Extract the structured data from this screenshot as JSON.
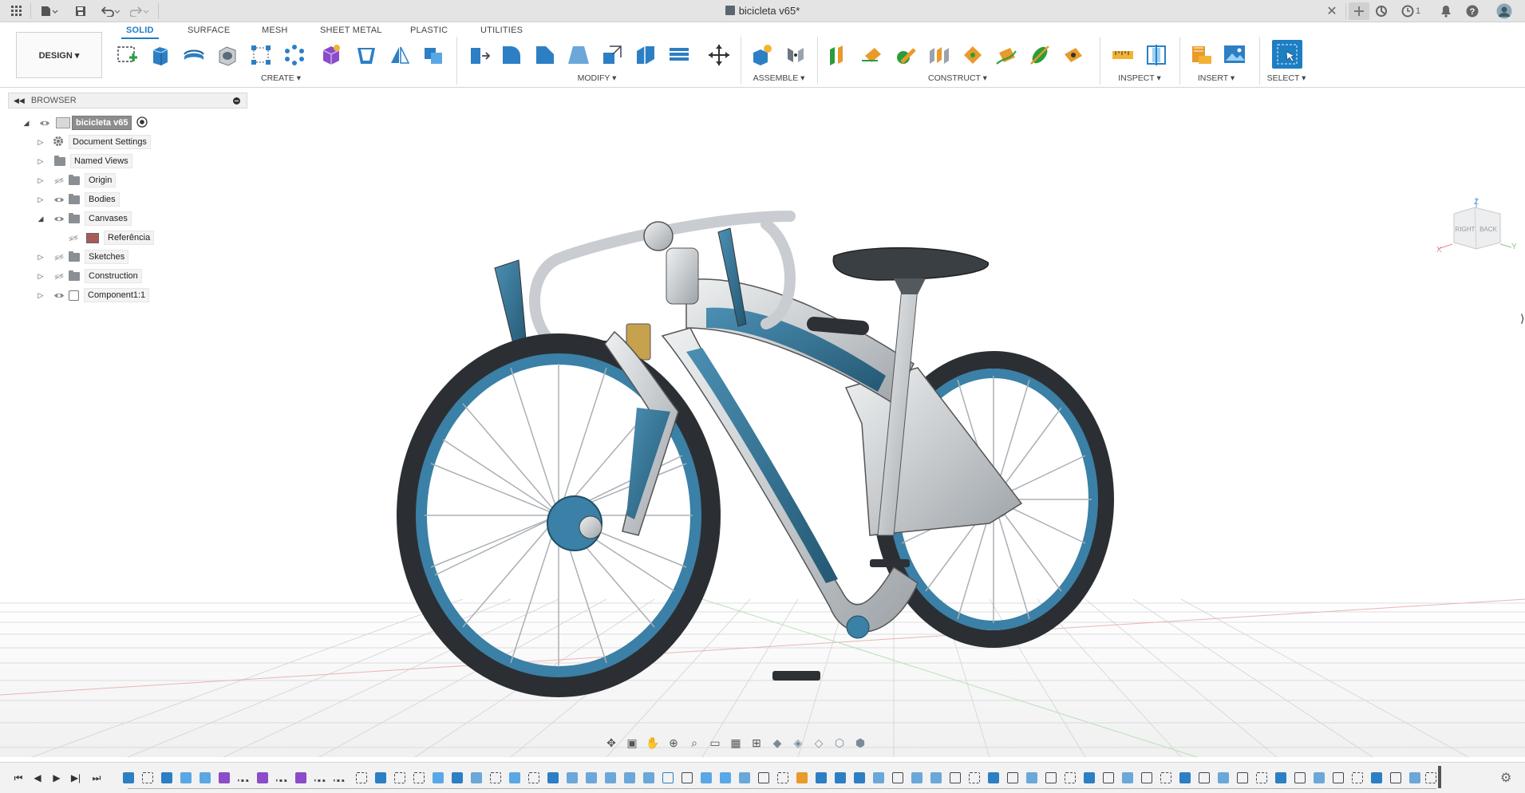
{
  "window": {
    "title": "bicicleta v65*"
  },
  "titlebar": {
    "notification_count": "1"
  },
  "ribbon": {
    "workspace_button": "DESIGN ▾",
    "tabs": [
      {
        "label": "SOLID",
        "active": true
      },
      {
        "label": "SURFACE",
        "active": false
      },
      {
        "label": "MESH",
        "active": false
      },
      {
        "label": "SHEET METAL",
        "active": false
      },
      {
        "label": "PLASTIC",
        "active": false
      },
      {
        "label": "UTILITIES",
        "active": false
      }
    ],
    "groups": {
      "create": "CREATE ▾",
      "modify": "MODIFY ▾",
      "assemble": "ASSEMBLE ▾",
      "construct": "CONSTRUCT ▾",
      "inspect": "INSPECT ▾",
      "insert": "INSERT ▾",
      "select": "SELECT ▾"
    },
    "accent_color": "#1d7ec2"
  },
  "browser": {
    "title": "BROWSER",
    "root": "bicicleta v65",
    "items": [
      {
        "label": "Document Settings",
        "icon": "gear-icon"
      },
      {
        "label": "Named Views",
        "icon": "folder-icon"
      },
      {
        "label": "Origin",
        "icon": "folder-icon"
      },
      {
        "label": "Bodies",
        "icon": "folder-icon"
      },
      {
        "label": "Canvases",
        "icon": "folder-icon"
      },
      {
        "label": "Referência",
        "icon": "canvas-image-icon"
      },
      {
        "label": "Sketches",
        "icon": "folder-icon"
      },
      {
        "label": "Construction",
        "icon": "folder-icon"
      },
      {
        "label": "Component1:1",
        "icon": "component-icon"
      }
    ]
  },
  "viewcube": {
    "right": "RIGHT",
    "back": "BACK",
    "z": "Z",
    "x": "X",
    "y": "Y"
  },
  "model": {
    "frame_accent": "#2f6e8e",
    "frame_silver": "#d5d8da"
  }
}
